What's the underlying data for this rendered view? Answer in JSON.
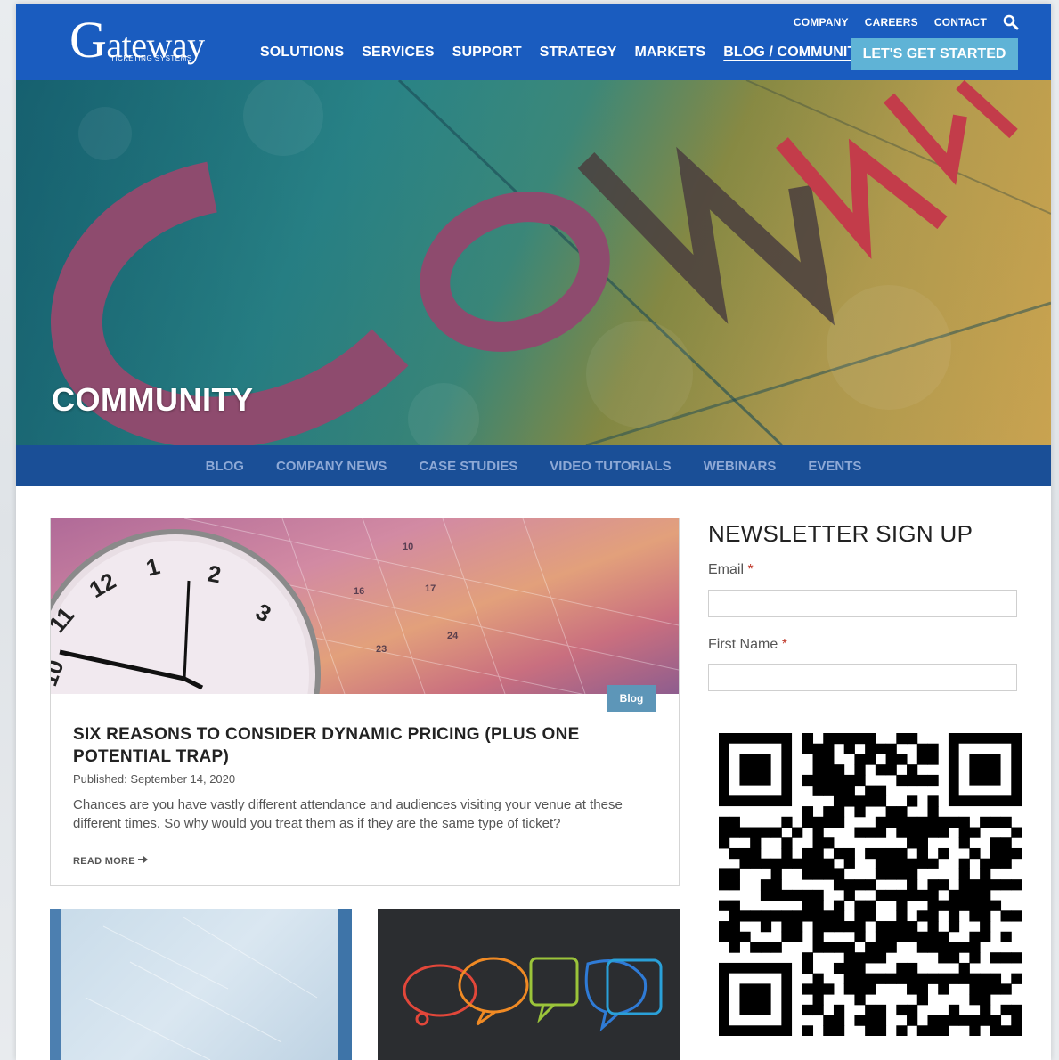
{
  "header": {
    "logo_main": "ateway",
    "logo_initial": "G",
    "logo_sub": "TICKETING SYSTEMS",
    "utility_nav": [
      "COMPANY",
      "CAREERS",
      "CONTACT"
    ],
    "main_nav": [
      "SOLUTIONS",
      "SERVICES",
      "SUPPORT",
      "STRATEGY",
      "MARKETS",
      "BLOG / COMMUNITY"
    ],
    "active_nav": "BLOG / COMMUNITY",
    "cta_label": "LET'S GET STARTED"
  },
  "hero": {
    "title": "COMMUNITY",
    "image_text": "COMMUNITY"
  },
  "subnav": [
    "BLOG",
    "COMPANY NEWS",
    "CASE STUDIES",
    "VIDEO TUTORIALS",
    "WEBINARS",
    "EVENTS"
  ],
  "featured_post": {
    "badge": "Blog",
    "title": "SIX REASONS TO CONSIDER DYNAMIC PRICING (PLUS ONE POTENTIAL TRAP)",
    "date": "Published: September 14, 2020",
    "excerpt": "Chances are you have vastly different attendance and audiences visiting your venue at these different times. So why would you treat them as if they are the same type of ticket?",
    "read_more": "READ MORE"
  },
  "newsletter": {
    "title": "NEWSLETTER SIGN UP",
    "email_label": "Email",
    "first_name_label": "First Name",
    "required_mark": "*"
  },
  "colors": {
    "header_bg": "#1a5cbf",
    "subnav_bg": "#1a4f97",
    "cta_bg": "#5fb3d6",
    "badge_bg": "#5d96b8"
  }
}
